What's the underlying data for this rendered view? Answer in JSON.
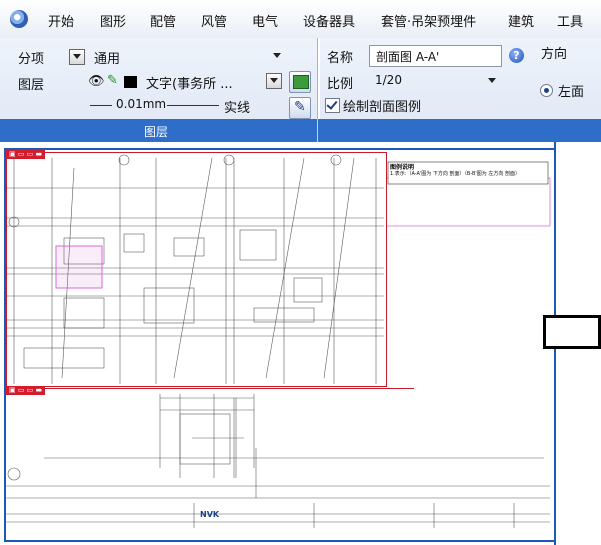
{
  "menu": {
    "items": [
      "开始",
      "图形",
      "配管",
      "风管",
      "电气",
      "设备器具",
      "套管·吊架预埋件",
      "建筑",
      "工具"
    ]
  },
  "layer_panel": {
    "category_label": "分项",
    "category_value": "通用",
    "layer_label": "图层",
    "layer_value": "文字(事务所 ...",
    "line_width": "0.01mm",
    "line_type": "实线",
    "group_label": "图层"
  },
  "section_panel": {
    "name_label": "名称",
    "name_value": "剖面图 A-A'",
    "scale_label": "比例",
    "scale_value": "1/20",
    "legend_checkbox_label": "绘制剖面图例",
    "direction_label": "方向",
    "direction_option": "左面"
  },
  "drawing": {
    "note_title": "图例说明",
    "note_line": "1.表示:（A-A'图为 下方向 剖面）（B-B'图为 左方向 剖面）",
    "company": "NVK"
  },
  "colors": {
    "ribbon_group_bar": "#2e6ec8",
    "viewport_border": "#c81c2a",
    "frame_border": "#1d57b8",
    "highlight": "#d86ad8"
  }
}
